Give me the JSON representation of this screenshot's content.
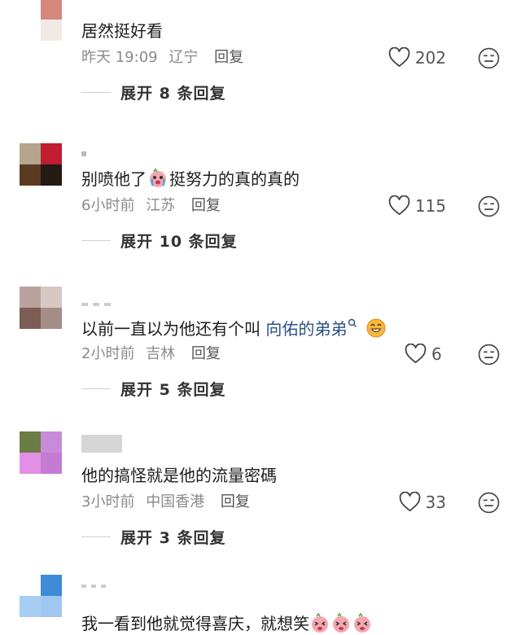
{
  "comments": [
    {
      "text": "居然挺好看",
      "time": "昨天 19:09",
      "location": "辽宁",
      "reply_label": "回复",
      "likes": "202",
      "expand_label": "展开 8 条回复",
      "avatar_colors": [
        "#ffffff",
        "#d4877a",
        "#ffffff",
        "#f2e9e4"
      ]
    },
    {
      "text_before": "别喷他了",
      "text_after": "挺努力的真的真的",
      "time": "6小时前",
      "location": "江苏",
      "reply_label": "回复",
      "likes": "115",
      "expand_label": "展开 10 条回复",
      "avatar_colors": [
        "#b5a58c",
        "#c01c32",
        "#5a3b22",
        "#241a14"
      ]
    },
    {
      "text_before": "以前一直以为他还有个叫 ",
      "link_text": "向佑的弟弟",
      "time": "2小时前",
      "location": "吉林",
      "reply_label": "回复",
      "likes": "6",
      "expand_label": "展开 5 条回复",
      "avatar_colors": [
        "#b8a39d",
        "#d8c7c3",
        "#7d5c54",
        "#a58e88"
      ]
    },
    {
      "text": "他的搞怪就是他的流量密碼",
      "time": "3小时前",
      "location": "中国香港",
      "reply_label": "回复",
      "likes": "33",
      "expand_label": "展开 3 条回复",
      "avatar_colors": [
        "#6b7d45",
        "#c78bd9",
        "#e48fe6",
        "#c47bd3"
      ]
    },
    {
      "text": "我一看到他就觉得喜庆，就想笑",
      "avatar_colors": [
        "#ffffff",
        "#3f8ad9",
        "#a7cdf2",
        "#9fc7f0"
      ]
    }
  ],
  "icons": {
    "like": "heart-outline-icon",
    "dislike": "meh-face-icon",
    "search": "search-icon",
    "emoji": "emoji-icon"
  },
  "colors": {
    "link": "#2d4f86",
    "meta": "#8a8a8a",
    "expand_line": "#cfcfcf"
  }
}
